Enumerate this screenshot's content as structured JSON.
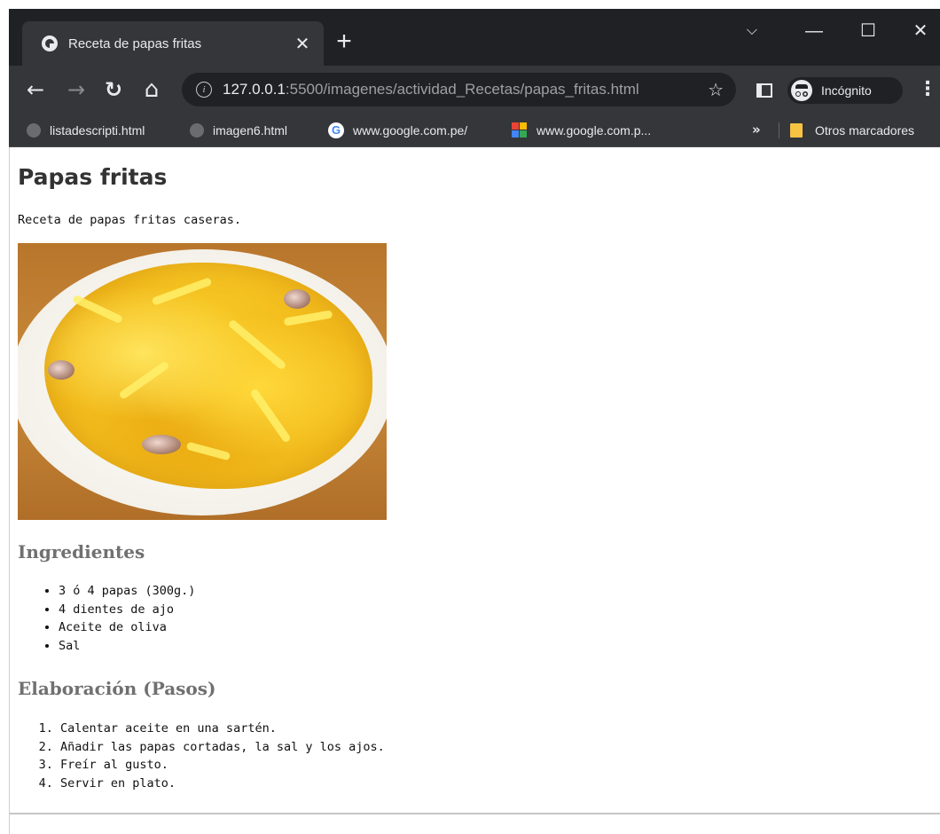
{
  "browser": {
    "tab": {
      "title": "Receta de papas fritas",
      "close": "✕"
    },
    "new_tab": "+",
    "window": {
      "chevron": "⌵",
      "minimize": "—",
      "maximize": "☐",
      "close": "✕"
    },
    "nav": {
      "back": "←",
      "forward": "→",
      "reload": "↻",
      "home": "⌂"
    },
    "address": {
      "info": "i",
      "host": "127.0.0.1",
      "rest": ":5500/imagenes/actividad_Recetas/papas_fritas.html"
    },
    "bookmark_star": "☆",
    "incognito_label": "Incógnito",
    "menu": "⋮",
    "bookmarks": [
      {
        "label": "listadescripti.html"
      },
      {
        "label": "imagen6.html"
      },
      {
        "label": "www.google.com.pe/"
      },
      {
        "label": "www.google.com.p..."
      }
    ],
    "bookmarks_more": "»",
    "other_bookmarks": "Otros marcadores"
  },
  "page": {
    "title": "Papas fritas",
    "intro": "Receta de papas fritas caseras.",
    "ingredients_heading": "Ingredientes",
    "ingredients": [
      "3 ó 4 papas (300g.)",
      "4 dientes de ajo",
      "Aceite de oliva",
      "Sal"
    ],
    "steps_heading": "Elaboración (Pasos)",
    "steps": [
      "Calentar aceite en una sartén.",
      "Añadir las papas cortadas, la sal y los ajos.",
      "Freír al gusto.",
      "Servir en plato."
    ]
  },
  "colors": {
    "chrome_dark": "#202124",
    "chrome_toolbar": "#35363a",
    "heading_gray": "#707070"
  }
}
